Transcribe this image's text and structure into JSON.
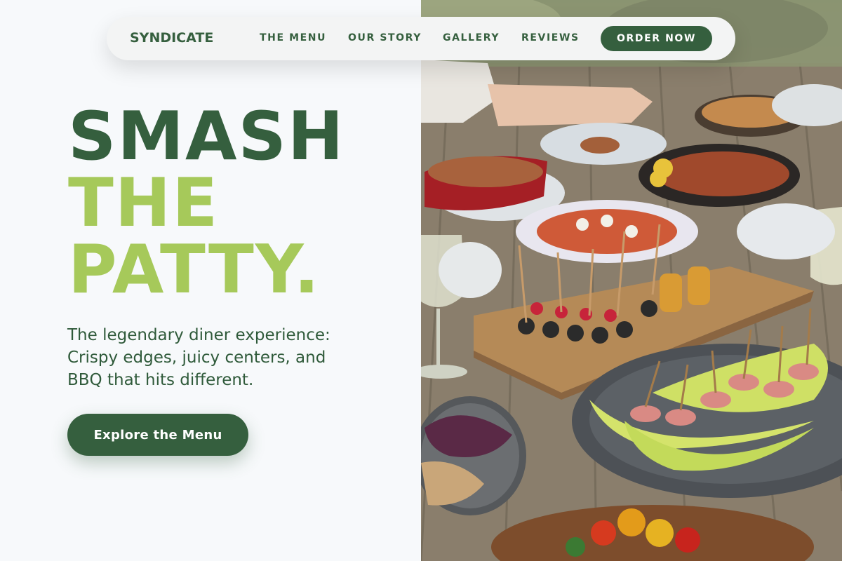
{
  "nav": {
    "logo": "SYNDICATE",
    "links": [
      {
        "label": "THE MENU"
      },
      {
        "label": "OUR STORY"
      },
      {
        "label": "GALLERY"
      },
      {
        "label": "REVIEWS"
      }
    ],
    "cta_label": "ORDER NOW"
  },
  "hero": {
    "headline_line1": "SMASH",
    "headline_line2": "THE",
    "headline_line3": "PATTY.",
    "subcopy_lines": [
      "The legendary diner experience:",
      "Crispy edges, juicy centers, and",
      "BBQ that hits different."
    ],
    "cta_label": "Explore the Menu"
  },
  "colors": {
    "brand_dark_green": "#355f3e",
    "brand_lime": "#a6c95a",
    "background": "#f7f9fb"
  }
}
